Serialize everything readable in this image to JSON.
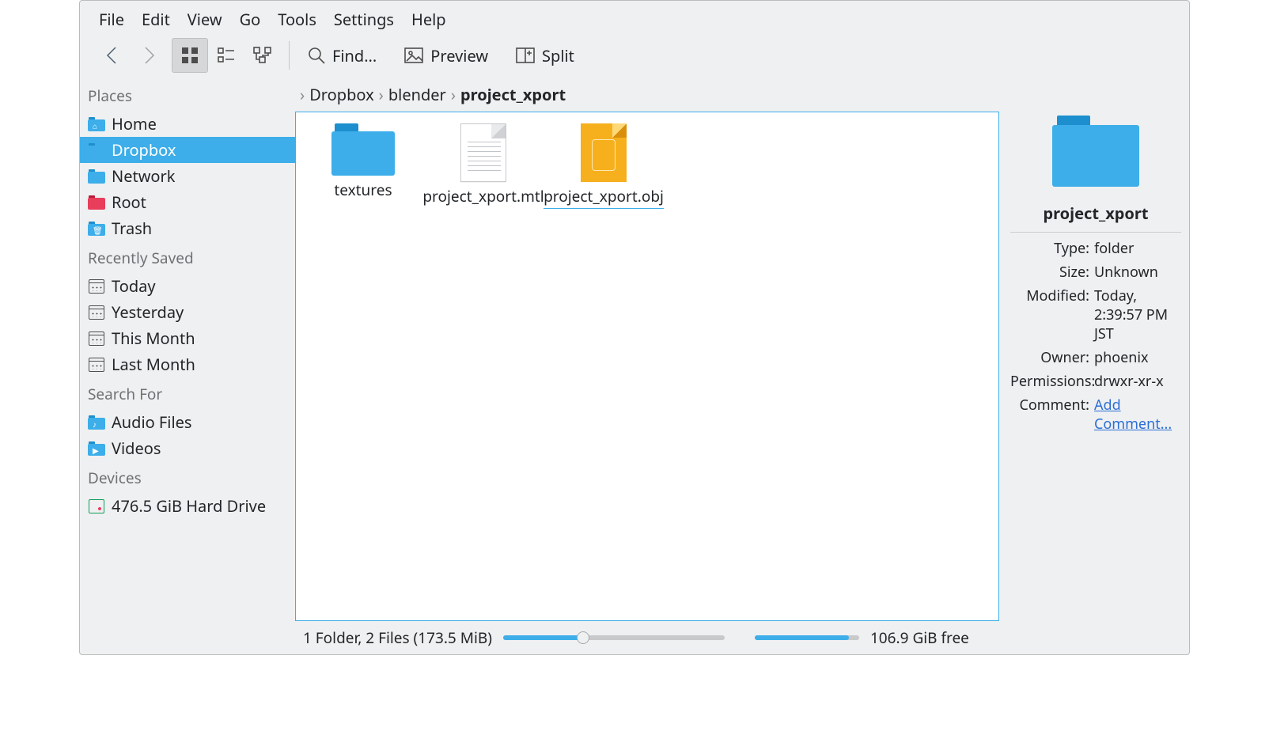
{
  "menu": {
    "items": [
      "File",
      "Edit",
      "View",
      "Go",
      "Tools",
      "Settings",
      "Help"
    ]
  },
  "toolbar": {
    "find": "Find...",
    "preview": "Preview",
    "split": "Split"
  },
  "sidebar": {
    "sections": [
      {
        "title": "Places",
        "items": [
          {
            "label": "Home",
            "id": "home",
            "icon": "folder-blue",
            "glyph": "⌂"
          },
          {
            "label": "Dropbox",
            "id": "dropbox",
            "icon": "folder-blue",
            "selected": true
          },
          {
            "label": "Network",
            "id": "network",
            "icon": "folder-blue"
          },
          {
            "label": "Root",
            "id": "root",
            "icon": "folder-red"
          },
          {
            "label": "Trash",
            "id": "trash",
            "icon": "folder-blue",
            "glyph": "🗑"
          }
        ]
      },
      {
        "title": "Recently Saved",
        "items": [
          {
            "label": "Today",
            "id": "today",
            "icon": "calendar"
          },
          {
            "label": "Yesterday",
            "id": "yesterday",
            "icon": "calendar"
          },
          {
            "label": "This Month",
            "id": "thismonth",
            "icon": "calendar"
          },
          {
            "label": "Last Month",
            "id": "lastmonth",
            "icon": "calendar"
          }
        ]
      },
      {
        "title": "Search For",
        "items": [
          {
            "label": "Audio Files",
            "id": "audio",
            "icon": "folder-blue",
            "glyph": "♪"
          },
          {
            "label": "Videos",
            "id": "videos",
            "icon": "folder-blue",
            "glyph": "▶"
          }
        ]
      },
      {
        "title": "Devices",
        "items": [
          {
            "label": "476.5 GiB Hard Drive",
            "id": "drive",
            "icon": "drive"
          }
        ]
      }
    ]
  },
  "breadcrumbs": [
    "Dropbox",
    "blender",
    "project_xport"
  ],
  "files": [
    {
      "label": "textures",
      "kind": "folder"
    },
    {
      "label": "project_xport.mtl",
      "kind": "doc"
    },
    {
      "label": "project_xport.obj",
      "kind": "obj",
      "selected": true
    }
  ],
  "info": {
    "name": "project_xport",
    "type_label": "Type:",
    "type": "folder",
    "size_label": "Size:",
    "size": "Unknown",
    "modified_label": "Modified:",
    "modified": "Today, 2:39:57 PM JST",
    "owner_label": "Owner:",
    "owner": "phoenix",
    "perm_label": "Permissions:",
    "perm": "drwxr-xr-x",
    "comment_label": "Comment:",
    "comment_link": "Add Comment..."
  },
  "status": {
    "summary": "1 Folder, 2 Files (173.5 MiB)",
    "free": "106.9 GiB free"
  }
}
